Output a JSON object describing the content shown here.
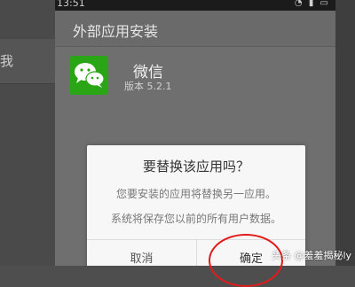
{
  "status_bar": {
    "time": "13:51"
  },
  "background": {
    "left_text": "我"
  },
  "installer": {
    "title": "外部应用安装",
    "app": {
      "name": "微信",
      "version": "版本 5.2.1",
      "icon": "wechat-icon",
      "icon_color": "#2aa515"
    }
  },
  "dialog": {
    "title": "要替换该应用吗？",
    "message1": "您要安装的应用将替换另一应用。",
    "message2": "系统将保存您以前的所有用户数据。",
    "cancel_label": "取消",
    "ok_label": "确定"
  },
  "annotation": {
    "color": "#e21b1b"
  },
  "watermark": "头条 @羞羞揭秘ly"
}
